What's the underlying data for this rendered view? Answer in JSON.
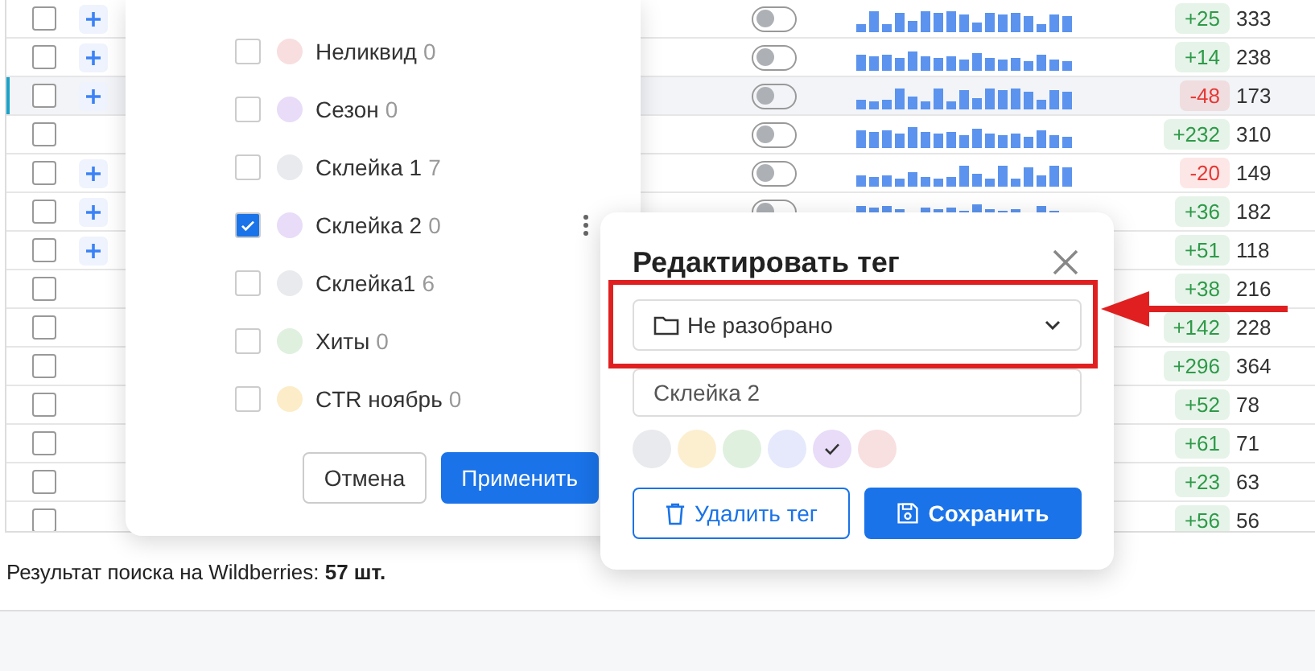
{
  "table": {
    "rows": [
      {
        "checked": false,
        "selected": false,
        "add_button": true,
        "toggle": {
          "on": false
        },
        "sparkline": true,
        "change": "+25",
        "color": "#2e9a48",
        "value": "333"
      },
      {
        "checked": false,
        "selected": false,
        "add_button": true,
        "toggle": {
          "on": false
        },
        "sparkline": true,
        "change": "+14",
        "color": "#2e9a48",
        "value": "238"
      },
      {
        "checked": false,
        "selected": true,
        "add_button": true,
        "toggle": {
          "on": false
        },
        "sparkline": true,
        "change": "-48",
        "color": "#e53935",
        "value": "173"
      },
      {
        "checked": false,
        "selected": false,
        "add_button": false,
        "toggle": {
          "on": false
        },
        "sparkline": true,
        "change": "+232",
        "color": "#2e9a48",
        "value": "310"
      },
      {
        "checked": false,
        "selected": false,
        "add_button": true,
        "toggle": {
          "on": false
        },
        "sparkline": true,
        "change": "-20",
        "color": "#e53935",
        "value": "149"
      },
      {
        "checked": false,
        "selected": false,
        "add_button": true,
        "toggle": {
          "on": false
        },
        "sparkline": true,
        "change": "+36",
        "color": "#2e9a48",
        "value": "182"
      },
      {
        "checked": false,
        "selected": false,
        "add_button": true,
        "change": "+51",
        "color": "#2e9a48",
        "value": "118"
      },
      {
        "checked": false,
        "selected": false,
        "add_button": false,
        "change": "+38",
        "color": "#2e9a48",
        "value": "216"
      },
      {
        "checked": false,
        "selected": false,
        "add_button": false,
        "change": "+142",
        "color": "#2e9a48",
        "value": "228"
      },
      {
        "checked": false,
        "selected": false,
        "add_button": false,
        "change": "+296",
        "color": "#2e9a48",
        "value": "364"
      },
      {
        "checked": false,
        "selected": false,
        "add_button": false,
        "change": "+52",
        "color": "#2e9a48",
        "value": "78"
      },
      {
        "checked": false,
        "selected": false,
        "add_button": false,
        "change": "+61",
        "color": "#2e9a48",
        "value": "71"
      },
      {
        "checked": false,
        "selected": false,
        "add_button": false,
        "change": "+23",
        "color": "#2e9a48",
        "value": "63"
      },
      {
        "checked": false,
        "selected": false,
        "add_button": false,
        "change": "+56",
        "color": "#2e9a48",
        "value": "56"
      }
    ]
  },
  "tag_menu": {
    "items": [
      {
        "name": "Неликвид",
        "count": "0",
        "color": "#f8dede",
        "checked": false,
        "hovered": false
      },
      {
        "name": "Сезон",
        "count": "0",
        "color": "#e8dcf8",
        "checked": false,
        "hovered": false
      },
      {
        "name": "Склейка 1",
        "count": "7",
        "color": "#e8eaed",
        "checked": false,
        "hovered": false
      },
      {
        "name": "Склейка 2",
        "count": "0",
        "color": "#e8dcf8",
        "checked": true,
        "hovered": true
      },
      {
        "name": "Склейка1",
        "count": "6",
        "color": "#e8eaed",
        "checked": false,
        "hovered": false
      },
      {
        "name": "Хиты",
        "count": "0",
        "color": "#dff0df",
        "checked": false,
        "hovered": false
      },
      {
        "name": "CTR ноябрь",
        "count": "0",
        "color": "#fcecc8",
        "checked": false,
        "hovered": false
      }
    ],
    "buttons": [
      {
        "label": "Отмена",
        "kind": "secondary"
      },
      {
        "label": "Применить",
        "kind": "primary"
      }
    ]
  },
  "edit_dialog": {
    "title": "Редактировать тег",
    "folder_select": {
      "value": "Не разобрано"
    },
    "name_field": {
      "value": "Склейка 2"
    },
    "swatches": [
      {
        "color": "#e8eaed",
        "selected": false
      },
      {
        "color": "#fcefd0",
        "selected": false
      },
      {
        "color": "#dff0df",
        "selected": false
      },
      {
        "color": "#e5e9fb",
        "selected": false
      },
      {
        "color": "#e8dcf8",
        "selected": true
      },
      {
        "color": "#f8dfe0",
        "selected": false
      }
    ],
    "buttons": [
      {
        "label": "Удалить тег",
        "kind": "delete"
      },
      {
        "label": "Сохранить",
        "kind": "save"
      }
    ]
  },
  "footer": {
    "text": "Результат поиска на Wildberries: **57 шт.**"
  }
}
